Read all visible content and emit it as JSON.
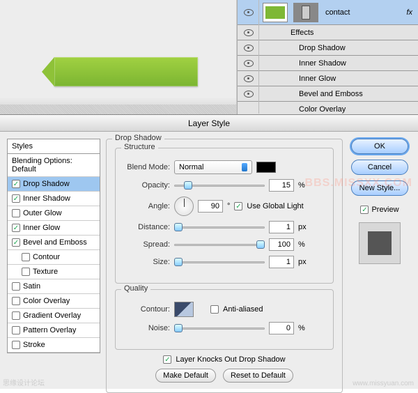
{
  "layers": {
    "main": {
      "name": "contact",
      "fx": "fx"
    },
    "effects_label": "Effects",
    "effects": [
      "Drop Shadow",
      "Inner Shadow",
      "Inner Glow",
      "Bevel and Emboss",
      "Color Overlay"
    ]
  },
  "dialog": {
    "title": "Layer Style",
    "styles_header": "Styles",
    "blending_options": "Blending Options: Default",
    "items": [
      {
        "label": "Drop Shadow",
        "checked": true,
        "selected": true
      },
      {
        "label": "Inner Shadow",
        "checked": true
      },
      {
        "label": "Outer Glow",
        "checked": false
      },
      {
        "label": "Inner Glow",
        "checked": true
      },
      {
        "label": "Bevel and Emboss",
        "checked": true
      },
      {
        "label": "Contour",
        "checked": false,
        "sub": true
      },
      {
        "label": "Texture",
        "checked": false,
        "sub": true
      },
      {
        "label": "Satin",
        "checked": false
      },
      {
        "label": "Color Overlay",
        "checked": false
      },
      {
        "label": "Gradient Overlay",
        "checked": false
      },
      {
        "label": "Pattern Overlay",
        "checked": false
      },
      {
        "label": "Stroke",
        "checked": false
      }
    ]
  },
  "panel": {
    "title": "Drop Shadow",
    "structure_label": "Structure",
    "quality_label": "Quality",
    "blend_mode_label": "Blend Mode:",
    "blend_mode_value": "Normal",
    "opacity_label": "Opacity:",
    "opacity_value": "15",
    "opacity_unit": "%",
    "angle_label": "Angle:",
    "angle_value": "90",
    "angle_unit": "°",
    "global_light": "Use Global Light",
    "distance_label": "Distance:",
    "distance_value": "1",
    "distance_unit": "px",
    "spread_label": "Spread:",
    "spread_value": "100",
    "spread_unit": "%",
    "size_label": "Size:",
    "size_value": "1",
    "size_unit": "px",
    "contour_label": "Contour:",
    "anti_aliased": "Anti-aliased",
    "noise_label": "Noise:",
    "noise_value": "0",
    "noise_unit": "%",
    "knockout": "Layer Knocks Out Drop Shadow",
    "make_default": "Make Default",
    "reset_default": "Reset to Default"
  },
  "buttons": {
    "ok": "OK",
    "cancel": "Cancel",
    "new_style": "New Style...",
    "preview": "Preview"
  },
  "watermark": "www.missyuan.com",
  "watermark2": "思缘设计论坛"
}
